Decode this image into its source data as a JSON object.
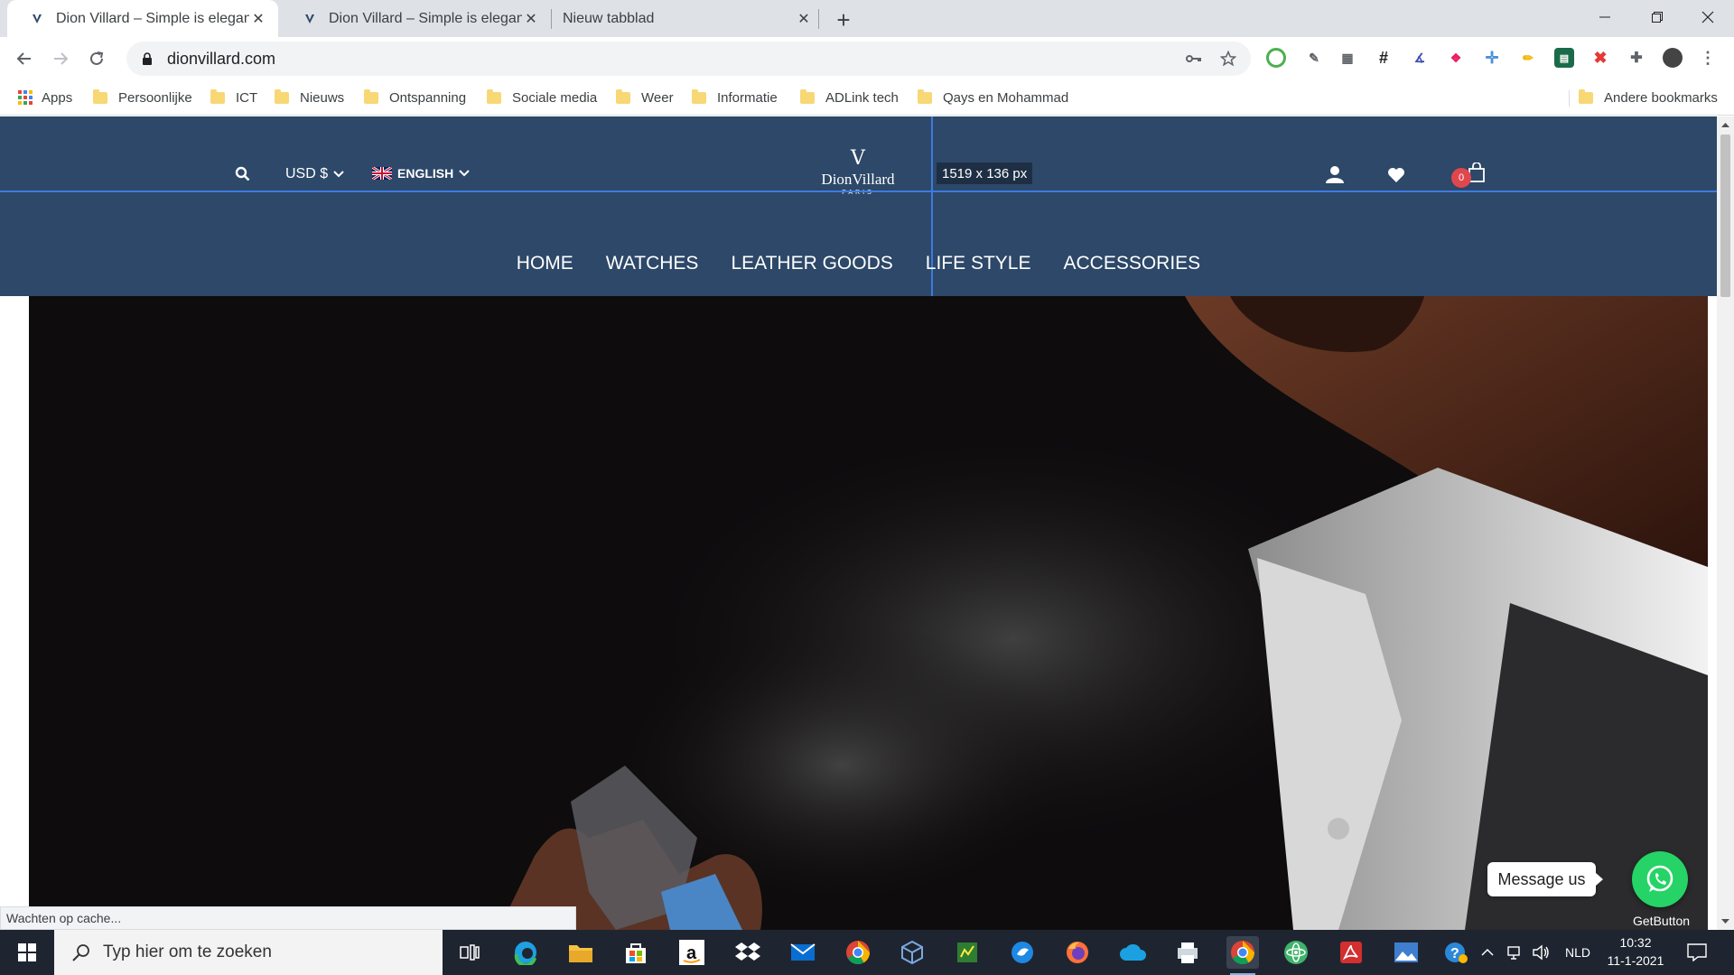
{
  "browser": {
    "tabs": [
      {
        "title": "Dion Villard – Simple is elegant",
        "active": true
      },
      {
        "title": "Dion Villard – Simple is elegant",
        "active": false
      },
      {
        "title": "Nieuw tabblad",
        "active": false
      }
    ],
    "close_glyph": "✕",
    "new_tab_glyph": "+",
    "url": "dionvillard.com",
    "bookmarks": {
      "apps": "Apps",
      "folders": [
        "Persoonlijke",
        "ICT",
        "Nieuws",
        "Ontspanning",
        "Sociale media",
        "Weer",
        "Informatie",
        "ADLink tech",
        "Qays en Mohammad"
      ],
      "other": "Andere bookmarks"
    },
    "status_text": "Wachten op cache..."
  },
  "site": {
    "currency": "USD $",
    "language": "ENGLISH",
    "logo": {
      "mark": "V",
      "name": "DionVillard",
      "sub": "PARIS"
    },
    "cart_count": "0",
    "ruler_readout": "1519 x 136 px",
    "menu": [
      "HOME",
      "WATCHES",
      "LEATHER GOODS",
      "LIFE STYLE",
      "ACCESSORIES"
    ],
    "whatsapp": {
      "message": "Message us",
      "brand": "GetButton"
    },
    "colors": {
      "header": "#2d4868",
      "hero": "#0e0c0d",
      "whatsapp": "#25d366",
      "badge": "#e0474c"
    }
  },
  "taskbar": {
    "search_placeholder": "Typ hier om te zoeken",
    "language": "NLD",
    "time": "10:32",
    "date": "11-1-2021"
  }
}
